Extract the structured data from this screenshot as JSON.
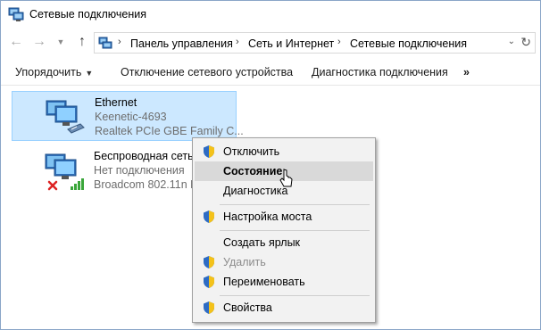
{
  "window": {
    "title": "Сетевые подключения"
  },
  "address": {
    "crumbs": [
      "Панель управления",
      "Сеть и Интернет",
      "Сетевые подключения"
    ]
  },
  "toolbar": {
    "organize": "Упорядочить",
    "disable_device": "Отключение сетевого устройства",
    "diagnose": "Диагностика подключения",
    "more": "»"
  },
  "connections": [
    {
      "name": "Ethernet",
      "status": "Keenetic-4693",
      "adapter": "Realtek PCIe GBE Family C...",
      "selected": true
    },
    {
      "name": "Беспроводная сеть",
      "status": "Нет подключения",
      "adapter": "Broadcom 802.11n N",
      "selected": false
    }
  ],
  "context_menu": {
    "items": [
      {
        "label": "Отключить",
        "icon": "shield-icon"
      },
      {
        "label": "Состояние",
        "icon": ""
      },
      {
        "label": "Диагностика",
        "icon": ""
      },
      {
        "label": "Настройка моста",
        "icon": "shield-icon"
      },
      {
        "label": "Создать ярлык",
        "icon": ""
      },
      {
        "label": "Удалить",
        "icon": "shield-icon"
      },
      {
        "label": "Переименовать",
        "icon": "shield-icon"
      },
      {
        "label": "Свойства",
        "icon": "shield-icon"
      }
    ]
  },
  "colors": {
    "selection": "#cce8ff",
    "selection_border": "#99d1ff",
    "menu_bg": "#f2f2f2",
    "menu_hover": "#d9d9d9"
  }
}
